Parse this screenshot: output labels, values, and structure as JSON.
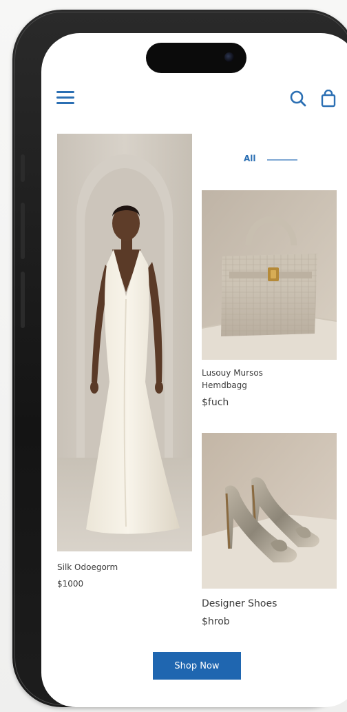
{
  "header": {
    "menu_icon": "hamburger-menu-icon",
    "search_icon": "search-icon",
    "bag_icon": "shopping-bag-icon"
  },
  "filter": {
    "label": "All"
  },
  "products": [
    {
      "name": "Silk Odoegorm",
      "price": "$1000"
    },
    {
      "name": "Lusouy Mursos",
      "name2": "Hemdbagg",
      "price": "$fuch"
    },
    {
      "name": "Designer Shoes",
      "price": "$hrob"
    }
  ],
  "cta": {
    "label": "Shop Now"
  },
  "colors": {
    "accent": "#1f66b0",
    "icon": "#2b6fb3"
  }
}
